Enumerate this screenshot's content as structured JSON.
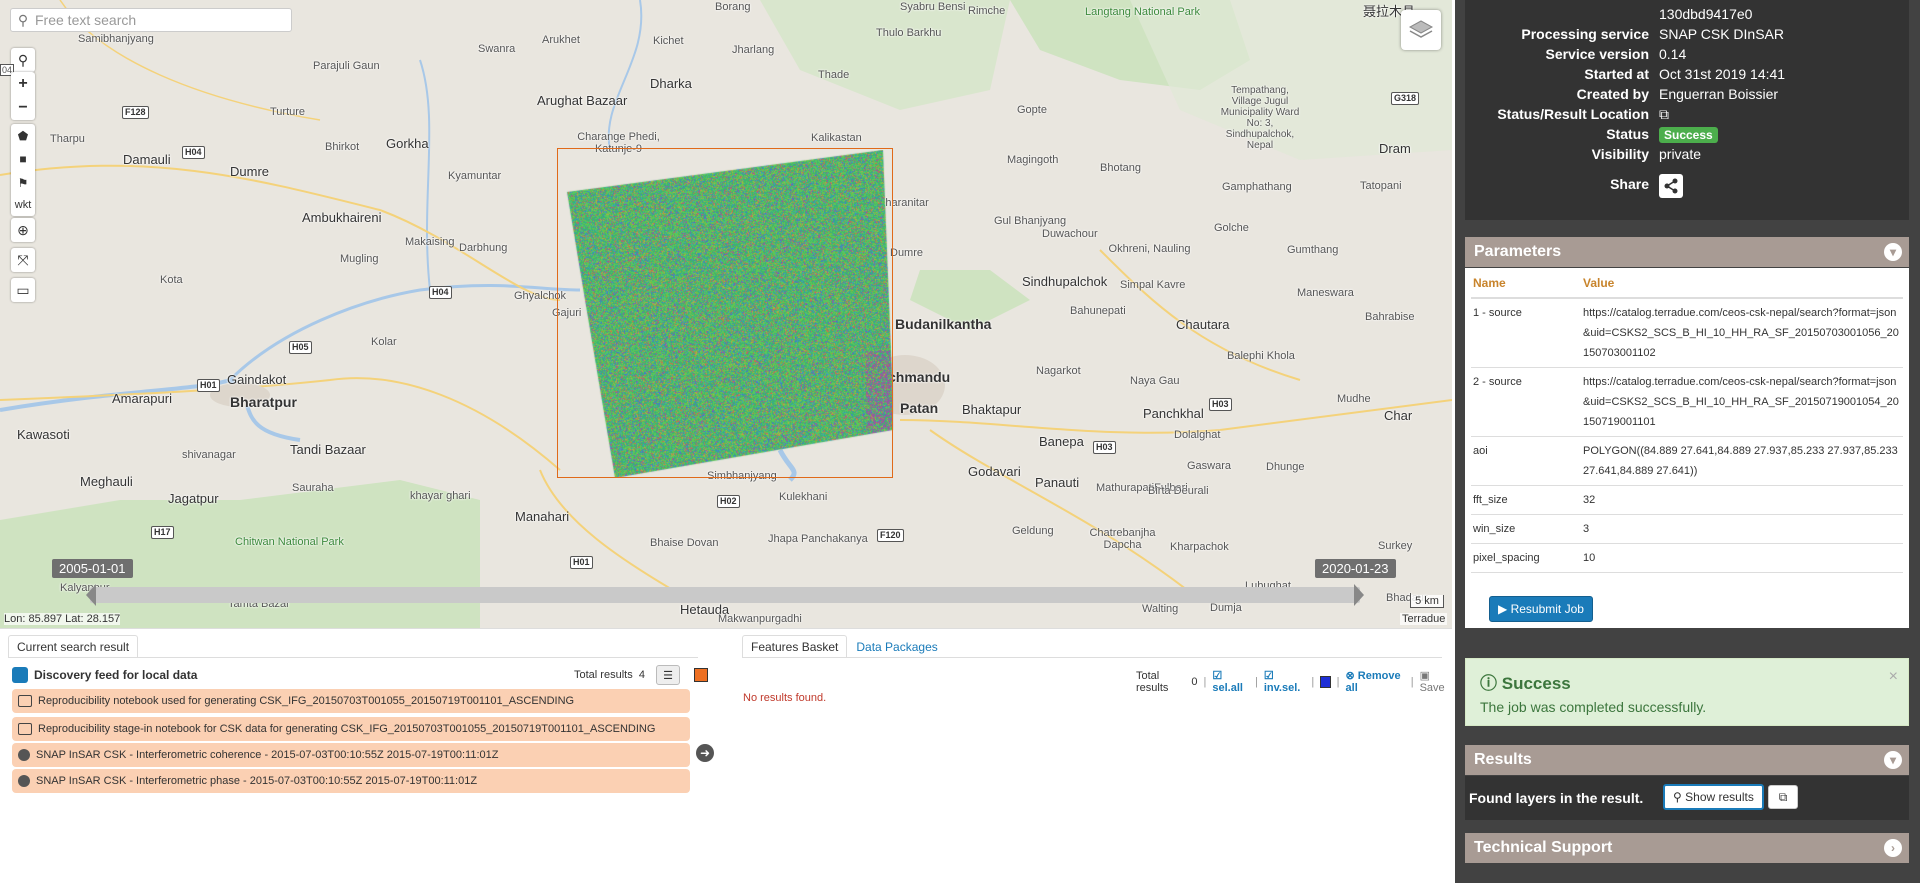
{
  "map": {
    "search_placeholder": "Free text search",
    "draw_wkt_label": "wkt",
    "zoom_in": "+",
    "zoom_out": "−",
    "edge_label": "04",
    "places": [
      {
        "name": "Borang",
        "cls": ""
      },
      {
        "name": "Syabru Bensi",
        "cls": ""
      },
      {
        "name": "Rimche",
        "cls": ""
      },
      {
        "name": "Langtang National Park",
        "cls": "green"
      },
      {
        "name": "聂拉木县",
        "cls": "med"
      },
      {
        "name": "Samibhanjyang",
        "cls": ""
      },
      {
        "name": "Swanra",
        "cls": ""
      },
      {
        "name": "Arukhet",
        "cls": ""
      },
      {
        "name": "Kichet",
        "cls": ""
      },
      {
        "name": "Jharlang",
        "cls": ""
      },
      {
        "name": "Thulo Barkhu",
        "cls": ""
      },
      {
        "name": "Parajuli Gaun",
        "cls": ""
      },
      {
        "name": "Arughat Bazaar",
        "cls": "med"
      },
      {
        "name": "Dharka",
        "cls": "med"
      },
      {
        "name": "Thade",
        "cls": ""
      },
      {
        "name": "Gopte",
        "cls": ""
      },
      {
        "name": "Tempathang, Village Jugul Municipality Ward No: 3, Sindhupalchok, Nepal",
        "cls": ""
      },
      {
        "name": "Tharpu",
        "cls": ""
      },
      {
        "name": "Turture",
        "cls": ""
      },
      {
        "name": "Gorkha",
        "cls": "med"
      },
      {
        "name": "Charange Phedi, Katunje-9",
        "cls": ""
      },
      {
        "name": "Kalikastan",
        "cls": ""
      },
      {
        "name": "Damauli",
        "cls": "med"
      },
      {
        "name": "Dumre",
        "cls": "med"
      },
      {
        "name": "Bhirkot",
        "cls": ""
      },
      {
        "name": "Kyamuntar",
        "cls": ""
      },
      {
        "name": "Magingoth",
        "cls": ""
      },
      {
        "name": "Bhotang",
        "cls": ""
      },
      {
        "name": "Dram",
        "cls": "med"
      },
      {
        "name": "Gamphathang",
        "cls": ""
      },
      {
        "name": "Kharanitar",
        "cls": ""
      },
      {
        "name": "Tatopani",
        "cls": ""
      },
      {
        "name": "Ambukhaireni",
        "cls": "med"
      },
      {
        "name": "Gul Bhanjyang",
        "cls": ""
      },
      {
        "name": "Golche",
        "cls": ""
      },
      {
        "name": "Duwachour",
        "cls": ""
      },
      {
        "name": "Makaising",
        "cls": ""
      },
      {
        "name": "Darbhung",
        "cls": ""
      },
      {
        "name": "Dumre",
        "cls": ""
      },
      {
        "name": "Okhreni, Nauling",
        "cls": ""
      },
      {
        "name": "Gumthang",
        "cls": ""
      },
      {
        "name": "Mugling",
        "cls": ""
      },
      {
        "name": "Sindhupalchok",
        "cls": "med"
      },
      {
        "name": "Simpal Kavre",
        "cls": ""
      },
      {
        "name": "Ghyalchok",
        "cls": ""
      },
      {
        "name": "Maneswara",
        "cls": ""
      },
      {
        "name": "Kota",
        "cls": ""
      },
      {
        "name": "Gajuri",
        "cls": ""
      },
      {
        "name": "Bahunepati",
        "cls": ""
      },
      {
        "name": "Bahrabise",
        "cls": ""
      },
      {
        "name": "Budanilkantha",
        "cls": "big"
      },
      {
        "name": "Chautara",
        "cls": "med"
      },
      {
        "name": "Kolar",
        "cls": ""
      },
      {
        "name": "Gaindakot",
        "cls": "med"
      },
      {
        "name": "Balephi Khola",
        "cls": ""
      },
      {
        "name": "Amarapuri",
        "cls": "med"
      },
      {
        "name": "Bharatpur",
        "cls": "big"
      },
      {
        "name": "chmandu",
        "cls": "big"
      },
      {
        "name": "Nagarkot",
        "cls": ""
      },
      {
        "name": "Naya Gau",
        "cls": ""
      },
      {
        "name": "Patan",
        "cls": "big"
      },
      {
        "name": "Bhaktapur",
        "cls": "med"
      },
      {
        "name": "Panchkhal",
        "cls": "med"
      },
      {
        "name": "Mudhe",
        "cls": ""
      },
      {
        "name": "Char",
        "cls": "med"
      },
      {
        "name": "Kawasoti",
        "cls": "med"
      },
      {
        "name": "shivanagar",
        "cls": ""
      },
      {
        "name": "Tandi Bazaar",
        "cls": "med"
      },
      {
        "name": "Banepa",
        "cls": "med"
      },
      {
        "name": "Dolalghat",
        "cls": ""
      },
      {
        "name": "Meghauli",
        "cls": "med"
      },
      {
        "name": "Godavari",
        "cls": "med"
      },
      {
        "name": "Gaswara",
        "cls": ""
      },
      {
        "name": "Dhunge",
        "cls": ""
      },
      {
        "name": "Sauraha",
        "cls": ""
      },
      {
        "name": "Simbhanjyang",
        "cls": ""
      },
      {
        "name": "Panauti",
        "cls": "med"
      },
      {
        "name": "MathurapatiFulbari",
        "cls": ""
      },
      {
        "name": "Birta Deurali",
        "cls": ""
      },
      {
        "name": "Jagatpur",
        "cls": "med"
      },
      {
        "name": "khayar ghari",
        "cls": ""
      },
      {
        "name": "Kulekhani",
        "cls": ""
      },
      {
        "name": "Manahari",
        "cls": "med"
      },
      {
        "name": "Geldung",
        "cls": ""
      },
      {
        "name": "Chatrebanjha Dapcha",
        "cls": ""
      },
      {
        "name": "Kharpachok",
        "cls": ""
      },
      {
        "name": "Bhaise Dovan",
        "cls": ""
      },
      {
        "name": "Surkey",
        "cls": ""
      },
      {
        "name": "Chitwan National Park",
        "cls": "green"
      },
      {
        "name": "Jhapa Panchakanya",
        "cls": ""
      },
      {
        "name": "Lubughat",
        "cls": ""
      },
      {
        "name": "Kalyanpur",
        "cls": ""
      },
      {
        "name": "Tamta Bazar",
        "cls": ""
      },
      {
        "name": "Hetauda",
        "cls": "med"
      },
      {
        "name": "Makwanpurgadhi",
        "cls": ""
      },
      {
        "name": "Walting",
        "cls": ""
      },
      {
        "name": "Dumja",
        "cls": ""
      },
      {
        "name": "Bhadaur",
        "cls": ""
      }
    ],
    "shields": [
      "F128",
      "H04",
      "H04",
      "H05",
      "H01",
      "G318",
      "H03",
      "H03",
      "H02",
      "F120",
      "H01",
      "H17"
    ],
    "timeline": {
      "start": "2005-01-01",
      "end": "2020-01-23"
    },
    "scale": "5 km",
    "coords": "Lon: 85.897 Lat: 28.157",
    "attribution": "Terradue"
  },
  "bottom": {
    "left_tab": "Current search result",
    "feed_title": "Discovery feed for local data",
    "total_label_left": "Total results",
    "total_left": "4",
    "results": [
      {
        "icon": "notebook-icon",
        "label": "Reproducibility notebook used for generating CSK_IFG_20150703T001055_20150719T001101_ASCENDING"
      },
      {
        "icon": "notebook-icon",
        "label": "Reproducibility stage-in notebook for CSK data for generating CSK_IFG_20150703T001055_20150719T001101_ASCENDING"
      },
      {
        "icon": "globe-icon",
        "label": "SNAP InSAR CSK - Interferometric coherence - 2015-07-03T00:10:55Z 2015-07-19T00:11:01Z"
      },
      {
        "icon": "globe-icon",
        "label": "SNAP InSAR CSK - Interferometric phase - 2015-07-03T00:10:55Z 2015-07-19T00:11:01Z"
      }
    ],
    "right_tabs": [
      "Features Basket",
      "Data Packages"
    ],
    "total_label_right": "Total results",
    "total_right": "0",
    "sel_all": "sel.all",
    "inv_sel": "inv.sel.",
    "remove_all": "Remove all",
    "save": "Save",
    "no_results": "No results found."
  },
  "details": {
    "rows": [
      {
        "key": "",
        "value": "130dbd9417e0"
      },
      {
        "key": "Processing service",
        "value": "SNAP CSK DInSAR"
      },
      {
        "key": "Service version",
        "value": "0.14"
      },
      {
        "key": "Started at",
        "value": "Oct 31st 2019 14:41"
      },
      {
        "key": "Created by",
        "value": "Enguerran Boissier"
      },
      {
        "key": "Status/Result Location",
        "value": ""
      },
      {
        "key": "Status",
        "value": "Success"
      },
      {
        "key": "Visibility",
        "value": "private"
      },
      {
        "key": "Share",
        "value": ""
      }
    ]
  },
  "parameters": {
    "title": "Parameters",
    "col_name": "Name",
    "col_value": "Value",
    "rows": [
      {
        "name": "1 - source",
        "value": "https://catalog.terradue.com/ceos-csk-nepal/search?format=json&uid=CSKS2_SCS_B_HI_10_HH_RA_SF_20150703001056_20150703001102"
      },
      {
        "name": "2 - source",
        "value": "https://catalog.terradue.com/ceos-csk-nepal/search?format=json&uid=CSKS2_SCS_B_HI_10_HH_RA_SF_20150719001054_20150719001101"
      },
      {
        "name": "aoi",
        "value": "POLYGON((84.889 27.641,84.889 27.937,85.233 27.937,85.233 27.641,84.889 27.641))"
      },
      {
        "name": "fft_size",
        "value": "32"
      },
      {
        "name": "win_size",
        "value": "3"
      },
      {
        "name": "pixel_spacing",
        "value": "10"
      }
    ],
    "resubmit": "Resubmit Job"
  },
  "alert": {
    "title": "Success",
    "message": "The job was completed successfully.",
    "close": "×"
  },
  "results": {
    "title": "Results",
    "found": "Found layers in the result.",
    "show": "Show results"
  },
  "support": {
    "title": "Technical Support"
  },
  "colors": {
    "accent": "#1a7bb9",
    "section": "#a89b94",
    "success": "#4cae4c",
    "aoi": "#e06a1a"
  }
}
